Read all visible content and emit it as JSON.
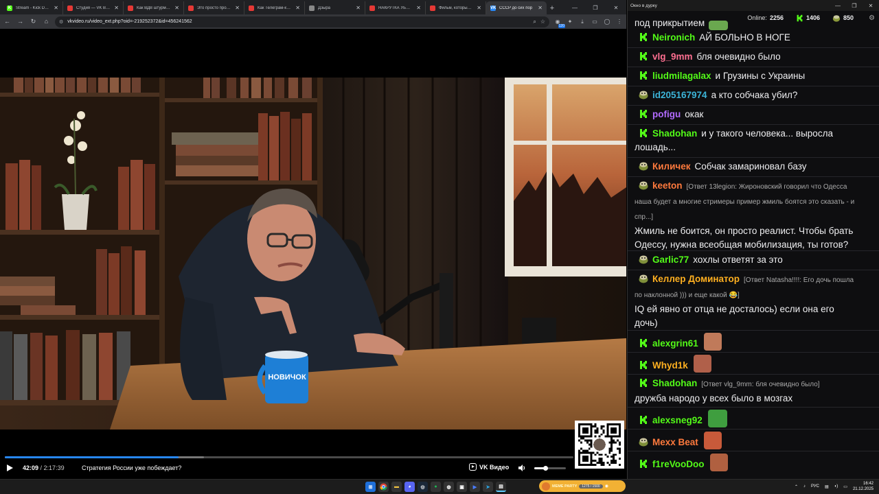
{
  "browser": {
    "tabs": [
      {
        "label": "Stream - Kick Dash",
        "color": "#53fc18",
        "fav": "K"
      },
      {
        "label": "Студия — VK Видео",
        "color": "#e53935",
        "fav": ""
      },
      {
        "label": "Как ВДВ штурмуют",
        "color": "#e53935",
        "fav": ""
      },
      {
        "label": "Это просто провал",
        "color": "#e53935",
        "fav": ""
      },
      {
        "label": "Как Телеграм-канал",
        "color": "#e53935",
        "fav": ""
      },
      {
        "label": "Дзыра",
        "color": "#888888",
        "fav": ""
      },
      {
        "label": "НАКРУТКА УБИВАЕТ",
        "color": "#e53935",
        "fav": ""
      },
      {
        "label": "Фильм, который сле",
        "color": "#e53935",
        "fav": ""
      },
      {
        "label": "СССР до сих пор",
        "color": "#2787f5",
        "fav": "VK",
        "active": true
      }
    ],
    "new_tab": "+",
    "window_controls": [
      "—",
      "❐",
      "✕"
    ],
    "url": "vkvideo.ru/video_ext.php?oid=-219252372&id=456241562",
    "ext_badge": "120"
  },
  "player": {
    "mug_text": "НОВИЧОК",
    "current_time": "42:09",
    "separator": " / ",
    "duration": "2:17:39",
    "title": "Стратегия России уже побеждает?",
    "brand": "VK Видео",
    "progress_fraction": 0.306,
    "volume_fraction": 0.35
  },
  "chat": {
    "window_title": "Окно в дурку",
    "online_label": "Online:",
    "online_count": "2256",
    "kick_count": "1406",
    "pepe_count": "850",
    "top_partial_text": "под прикрытием",
    "messages": [
      {
        "user": "Neironich",
        "color": "#53fc18",
        "badge": "kick",
        "text": "АЙ БОЛЬНО В НОГЕ"
      },
      {
        "user": "vlg_9mm",
        "color": "#ff6f91",
        "badge": "kick",
        "text": "бля очевидно было"
      },
      {
        "user": "liudmilagalax",
        "color": "#53fc18",
        "badge": "kick",
        "text": "и Грузины с Украины"
      },
      {
        "user": "id205167974",
        "color": "#3cb4d8",
        "badge": "pepe",
        "text": "а кто собчака убил?"
      },
      {
        "user": "pofigu",
        "color": "#b26bff",
        "badge": "kick",
        "text": "окак"
      },
      {
        "user": "Shadohan",
        "color": "#53fc18",
        "badge": "kick",
        "text": "и у такого человека... выросла",
        "text2": "лошадь..."
      },
      {
        "user": "Киличек",
        "color": "#ff7a3d",
        "badge": "pepe",
        "text": "Собчак замариновал базу"
      },
      {
        "user": "keeton",
        "color": "#ff7a3d",
        "badge": "pepe",
        "reply": "[Ответ 13legion: Жироновский говорил что  Одесса",
        "reply2": "наша будет а многие стримеры пример жмиль боятся это сказать - и",
        "reply3": "спр...]",
        "text": "Жмиль не боится, он просто реалист. Чтобы брать",
        "text2": "Одессу, нужна всеобщая мобилизация, ты готов?"
      },
      {
        "user": "Garlic77",
        "color": "#53fc18",
        "badge": "pepe",
        "text": "хохлы ответят за это"
      },
      {
        "user": "Келлер Доминатор",
        "color": "#ffb020",
        "badge": "pepe",
        "reply": "[Ответ Natasha!!!!: Его дочь пошла",
        "reply2": "по наклонной ))) и еще какой 😂]",
        "text": "IQ ей явно от отца не досталось) если она его",
        "text2": "дочь)"
      },
      {
        "user": "alexgrin61",
        "color": "#53fc18",
        "badge": "kick",
        "text": ""
      },
      {
        "user": "Whyd1k",
        "color": "#ffb020",
        "badge": "kick",
        "text": ""
      },
      {
        "user": "Shadohan",
        "color": "#53fc18",
        "badge": "kick",
        "reply": "[Ответ vlg_9mm: бля очевидно было]",
        "text": "дружба народо у всех было в мозгах"
      },
      {
        "user": "alexsneg92",
        "color": "#53fc18",
        "badge": "kick",
        "text": ""
      },
      {
        "user": "Mexx Beat",
        "color": "#ff7a3d",
        "badge": "pepe",
        "text": ""
      },
      {
        "user": "f1reVooDoo",
        "color": "#53fc18",
        "badge": "kick",
        "text": ""
      }
    ]
  },
  "taskbar": {
    "widget_title": "MEME PARTY",
    "widget_progress": "1275 / 1500",
    "lang": "РУС",
    "time": "16:42",
    "date": "21.12.2025"
  },
  "icons": {
    "play": "play-icon",
    "volume": "volume-icon",
    "kick_badge": "kick-badge-icon",
    "pepe_badge": "pepe-badge-icon"
  }
}
